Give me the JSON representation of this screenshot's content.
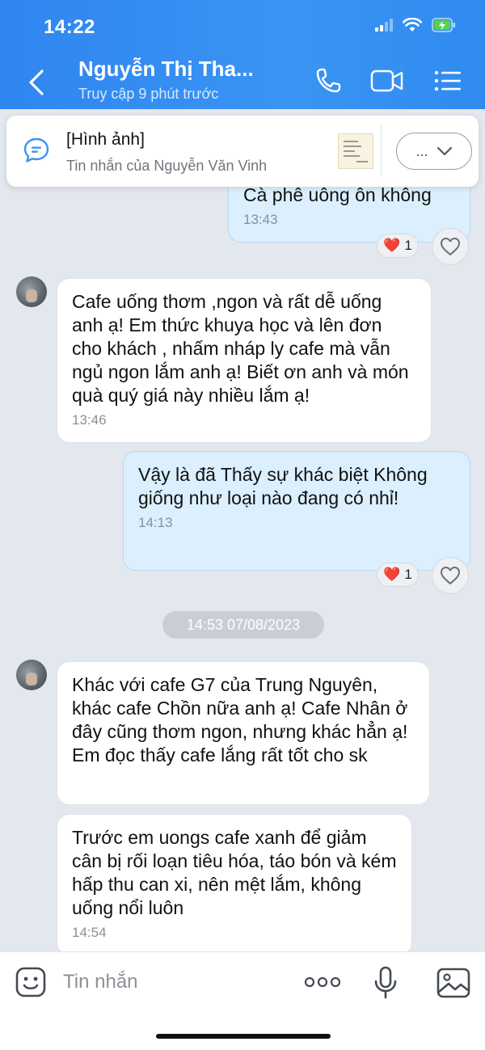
{
  "status_bar": {
    "time": "14:22"
  },
  "header": {
    "contact_name": "Nguyễn Thị Tha...",
    "last_seen": "Truy cập 9 phút trước",
    "icons": [
      "back-icon",
      "phone-icon",
      "video-call-icon",
      "menu-icon"
    ]
  },
  "pinned": {
    "title": "[Hình ảnh]",
    "subtitle": "Tin nhắn của Nguyễn Văn Vinh",
    "more_label": "..."
  },
  "messages": [
    {
      "direction": "out",
      "text": "Cà phê uông ôn không",
      "time": "13:43",
      "reaction": {
        "emoji": "❤️",
        "count": "1"
      }
    },
    {
      "direction": "in",
      "text": "Cafe uống thơm ,ngon và rất dễ uống anh ạ! Em thức khuya học và lên đơn cho khách , nhấm nháp ly cafe mà vẫn ngủ ngon lắm anh ạ! Biết ơn anh và món quà quý giá này nhiều lắm ạ!",
      "time": "13:46"
    },
    {
      "direction": "out",
      "text": "Vậy là đã Thấy sự khác biệt Không giống như loại nào đang có nhỉ!",
      "time": "14:13",
      "reaction": {
        "emoji": "❤️",
        "count": "1"
      }
    },
    {
      "direction": "in",
      "text": "Khác với cafe G7 của Trung Nguyên, khác cafe Chồn nữa anh ạ! Cafe Nhân ở đây cũng thơm ngon, nhưng khác hẳn ạ! Em đọc thấy cafe lắng rất tốt cho sk"
    },
    {
      "direction": "in",
      "text": "Trước em uongs cafe xanh để giảm cân bị rối loạn tiêu hóa, táo bón và kém hấp thu can xi, nên mệt lắm, không uống nổi luôn",
      "time": "14:54"
    }
  ],
  "date_divider": "14:53 07/08/2023",
  "composer": {
    "placeholder": "Tin nhắn"
  },
  "colors": {
    "header_blue": "#3a94f3",
    "out_bubble": "#dbeffe",
    "in_bubble": "#ffffff",
    "background": "#e3e7ee"
  }
}
